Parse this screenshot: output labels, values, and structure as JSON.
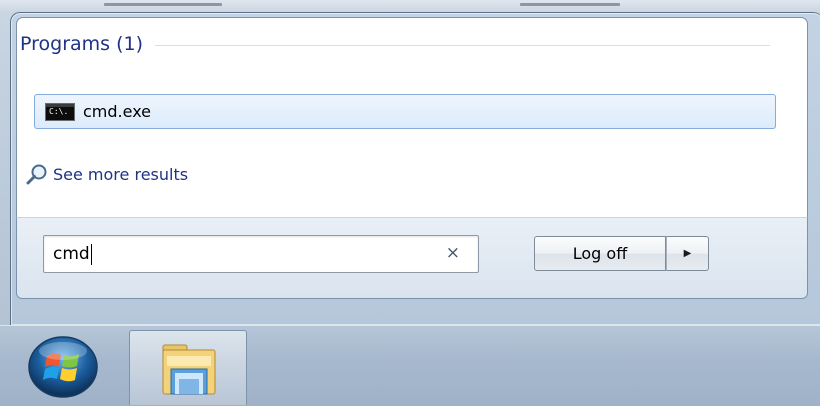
{
  "start_menu": {
    "section_title": "Programs (1)",
    "program": {
      "label": "cmd.exe",
      "icon": "console-icon",
      "icon_glyph": "C:\\."
    },
    "see_more": {
      "label": "See more results",
      "icon": "magnifier-icon"
    },
    "search": {
      "value": "cmd",
      "clear_icon": "×"
    },
    "power": {
      "label": "Log off",
      "arrow": "▶"
    }
  },
  "taskbar": {
    "start_icon": "windows-orb-icon",
    "pinned_icon": "windows-explorer-icon"
  },
  "colors": {
    "header_text": "#1e3287",
    "highlight_border": "#84acdd",
    "highlight_fill": "#dcebfc"
  }
}
